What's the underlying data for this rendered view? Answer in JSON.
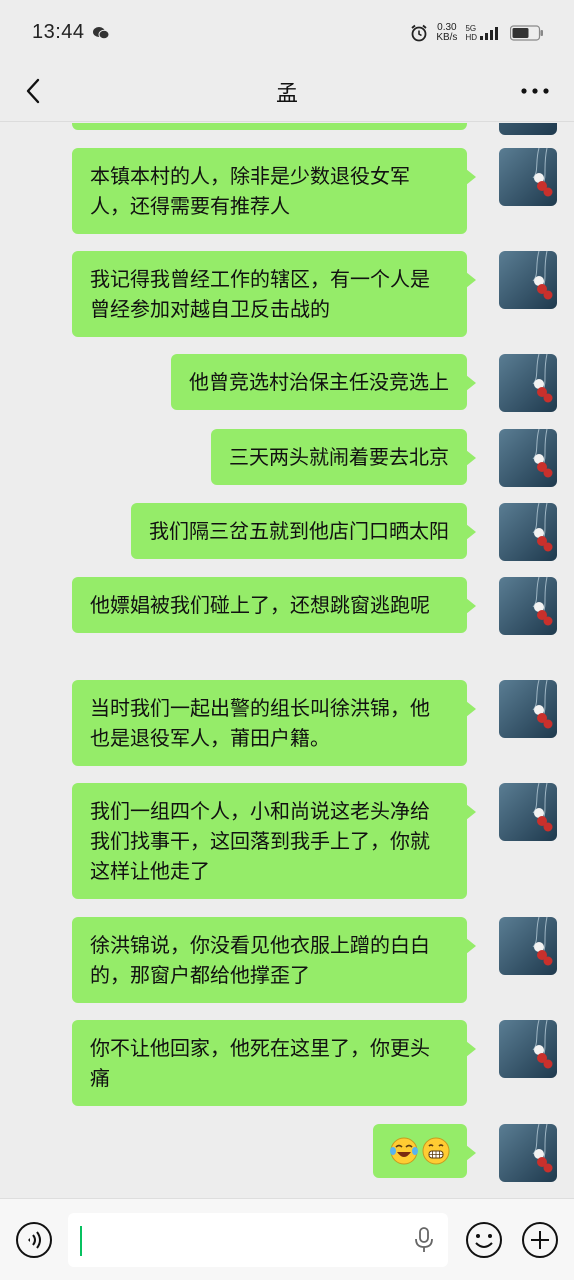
{
  "status_bar": {
    "time": "13:44",
    "net_speed_value": "0.30",
    "net_speed_unit": "KB/s",
    "net_tag_top": "5G",
    "net_tag_sub": "HD"
  },
  "header": {
    "title": "孟"
  },
  "messages": [
    {
      "text": "本镇本村的人，除非是少数退役女军人，还得需要有推荐人"
    },
    {
      "text": "我记得我曾经工作的辖区，有一个人是曾经参加对越自卫反击战的"
    },
    {
      "text": "他曾竞选村治保主任没竞选上"
    },
    {
      "text": "三天两头就闹着要去北京"
    },
    {
      "text": "我们隔三岔五就到他店门口晒太阳"
    },
    {
      "text": "他嫖娼被我们碰上了，还想跳窗逃跑呢"
    },
    {
      "text": "当时我们一起出警的组长叫徐洪锦，他也是退役军人，莆田户籍。"
    },
    {
      "text": "我们一组四个人，小和尚说这老头净给我们找事干，这回落到我手上了，你就这样让他走了"
    },
    {
      "text": "徐洪锦说，你没看见他衣服上蹭的白白的，那窗户都给他撑歪了"
    },
    {
      "text": "你不让他回家，他死在这里了，你更头痛"
    }
  ],
  "emoji_message": {
    "emojis": [
      "tears-of-joy",
      "grinning-face"
    ]
  },
  "colors": {
    "bubble": "#95ec69",
    "background": "#ededed",
    "accent": "#07c160"
  }
}
